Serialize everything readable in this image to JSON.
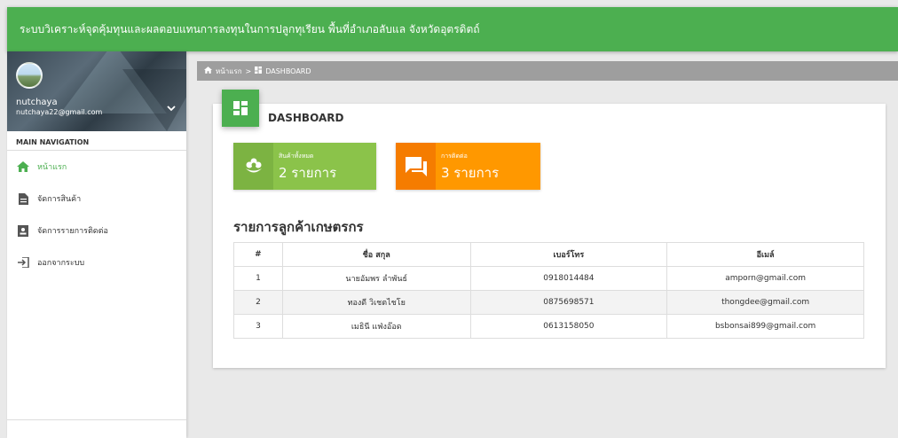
{
  "app": {
    "title": "ระบบวิเคราะห์จุดคุ้มทุนและผลตอบแทนการลงทุนในการปลูกทุเรียน พื้นที่อำเภอลับแล จังหวัดอุตรดิตถ์",
    "accent_color": "#4caf50"
  },
  "user": {
    "name": "nutchaya",
    "email": "nutchaya22@gmail.com"
  },
  "sidebar": {
    "header": "MAIN NAVIGATION",
    "items": [
      {
        "label": "หน้าแรก",
        "icon": "home-icon",
        "active": true
      },
      {
        "label": "จัดการสินค้า",
        "icon": "document-icon",
        "active": false
      },
      {
        "label": "จัดการรายการติดต่อ",
        "icon": "contact-card-icon",
        "active": false
      },
      {
        "label": "ออกจากระบบ",
        "icon": "logout-icon",
        "active": false
      }
    ]
  },
  "breadcrumb": {
    "home": "หน้าแรก",
    "separator": ">",
    "current": "DASHBOARD"
  },
  "dashboard": {
    "title": "DASHBOARD",
    "boxes": [
      {
        "label": "สินค้าทั้งหมด",
        "value": "2 รายการ",
        "icon": "flower-icon",
        "color": "#8bc34a"
      },
      {
        "label": "การติดต่อ",
        "value": "3 รายการ",
        "icon": "chat-icon",
        "color": "#ff9800"
      }
    ],
    "section_title": "รายการลูกค้าเกษตรกร",
    "table": {
      "headers": [
        "#",
        "ชื่อ สกุล",
        "เบอร์โทร",
        "อีเมล์"
      ],
      "rows": [
        [
          "1",
          "นายอัมพร ลำพันธ์",
          "0918014484",
          "amporn@gmail.com"
        ],
        [
          "2",
          "ทองดี วิเชตไชโย",
          "0875698571",
          "thongdee@gmail.com"
        ],
        [
          "3",
          "เมธินี แฟ่งอ๊อด",
          "0613158050",
          "bsbonsai899@gmail.com"
        ]
      ]
    }
  }
}
